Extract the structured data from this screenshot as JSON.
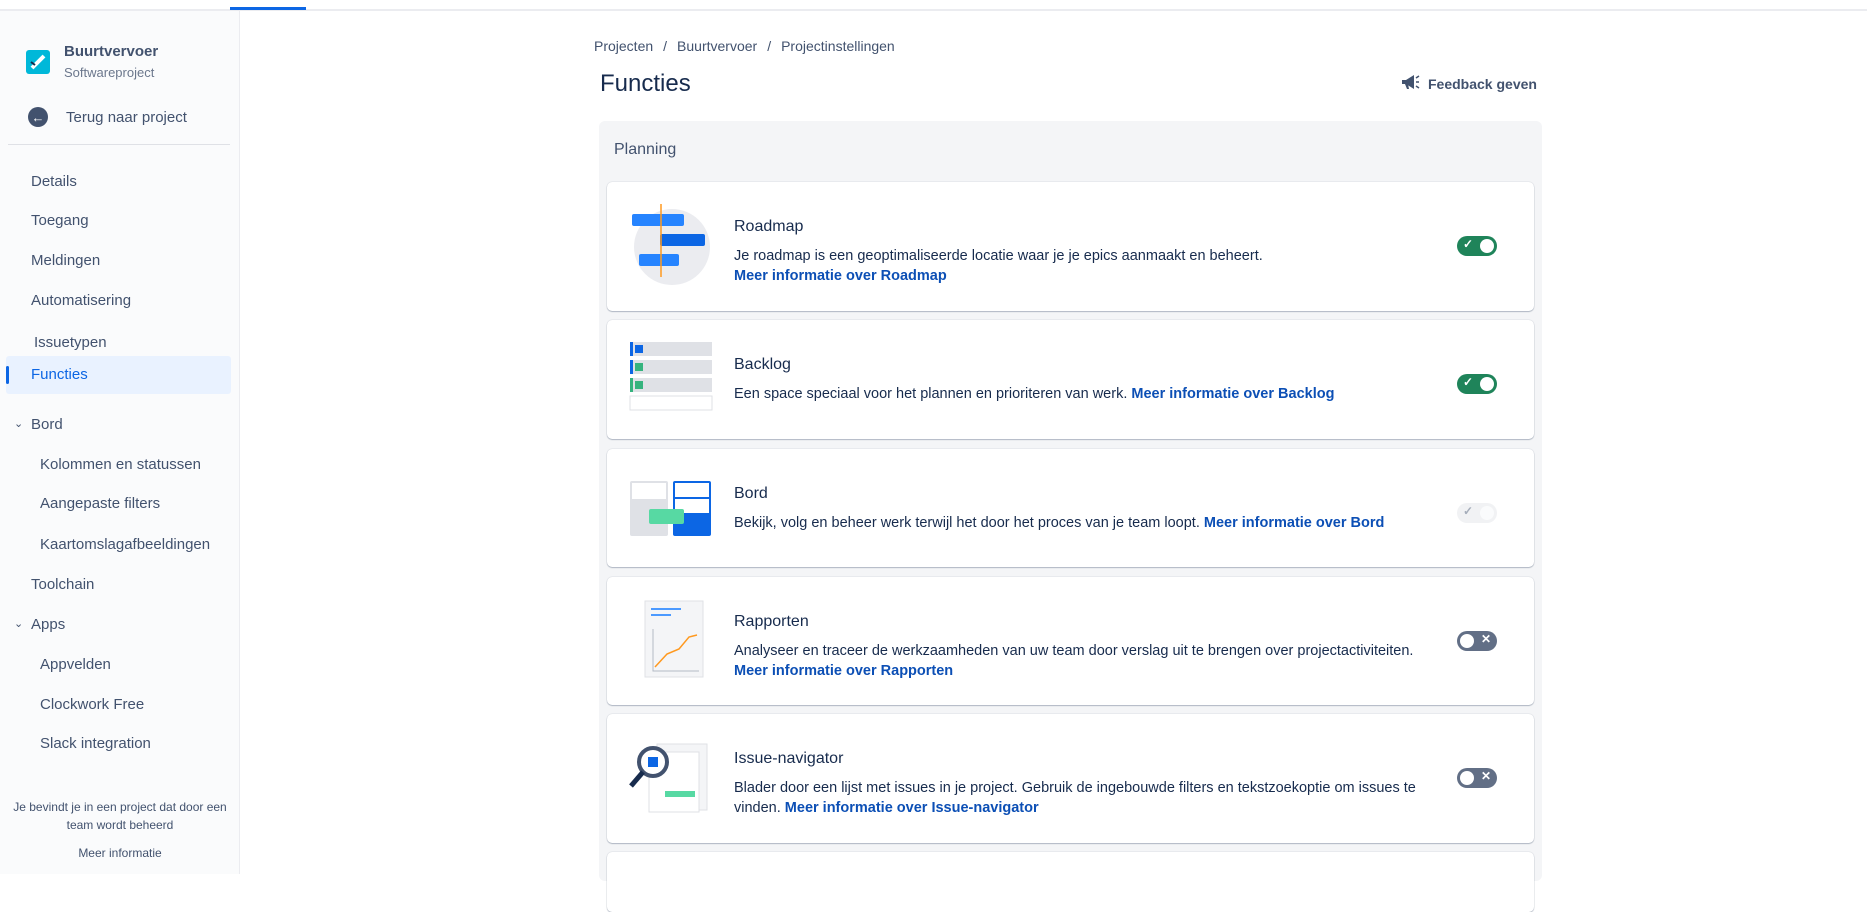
{
  "project": {
    "name": "Buurtvervoer",
    "type": "Softwareproject",
    "back": "Terug naar project"
  },
  "nav": [
    {
      "label": "Details"
    },
    {
      "label": "Toegang"
    },
    {
      "label": "Meldingen"
    },
    {
      "label": "Automatisering"
    },
    {
      "label": "Issuetypen"
    },
    {
      "label": "Functies",
      "active": true
    },
    {
      "label": "Bord",
      "expanded": true
    },
    {
      "label": "Kolommen en statussen"
    },
    {
      "label": "Aangepaste filters"
    },
    {
      "label": "Kaartomslagafbeeldingen"
    },
    {
      "label": "Toolchain"
    },
    {
      "label": "Apps",
      "expanded": true
    },
    {
      "label": "Appvelden"
    },
    {
      "label": "Clockwork Free"
    },
    {
      "label": "Slack integration"
    }
  ],
  "footer": {
    "line1": "Je bevindt je in een project dat door een",
    "line2": "team wordt beheerd",
    "link": "Meer informatie"
  },
  "breadcrumb": [
    "Projecten",
    "Buurtvervoer",
    "Projectinstellingen"
  ],
  "title": "Functies",
  "feedback": "Feedback geven",
  "section": "Planning",
  "features": [
    {
      "title": "Roadmap",
      "desc": "Je roadmap is een geoptimaliseerde locatie waar je je epics aanmaakt en beheert.",
      "link": "Meer informatie over Roadmap",
      "state": "on"
    },
    {
      "title": "Backlog",
      "desc": "Een space speciaal voor het plannen en prioriteren van werk.",
      "link": "Meer informatie over Backlog",
      "state": "on"
    },
    {
      "title": "Bord",
      "desc": "Bekijk, volg en beheer werk terwijl het door het proces van je team loopt.",
      "link": "Meer informatie over Bord",
      "state": "disabled-on"
    },
    {
      "title": "Rapporten",
      "desc": "Analyseer en traceer de werkzaamheden van uw team door verslag uit te brengen over projectactiviteiten.",
      "link": "Meer informatie over Rapporten",
      "state": "off"
    },
    {
      "title": "Issue-navigator",
      "desc": "Blader door een lijst met issues in je project. Gebruik de ingebouwde filters en tekstzoekoptie om issues te vinden.",
      "link": "Meer informatie over Issue-navigator",
      "state": "off"
    }
  ]
}
